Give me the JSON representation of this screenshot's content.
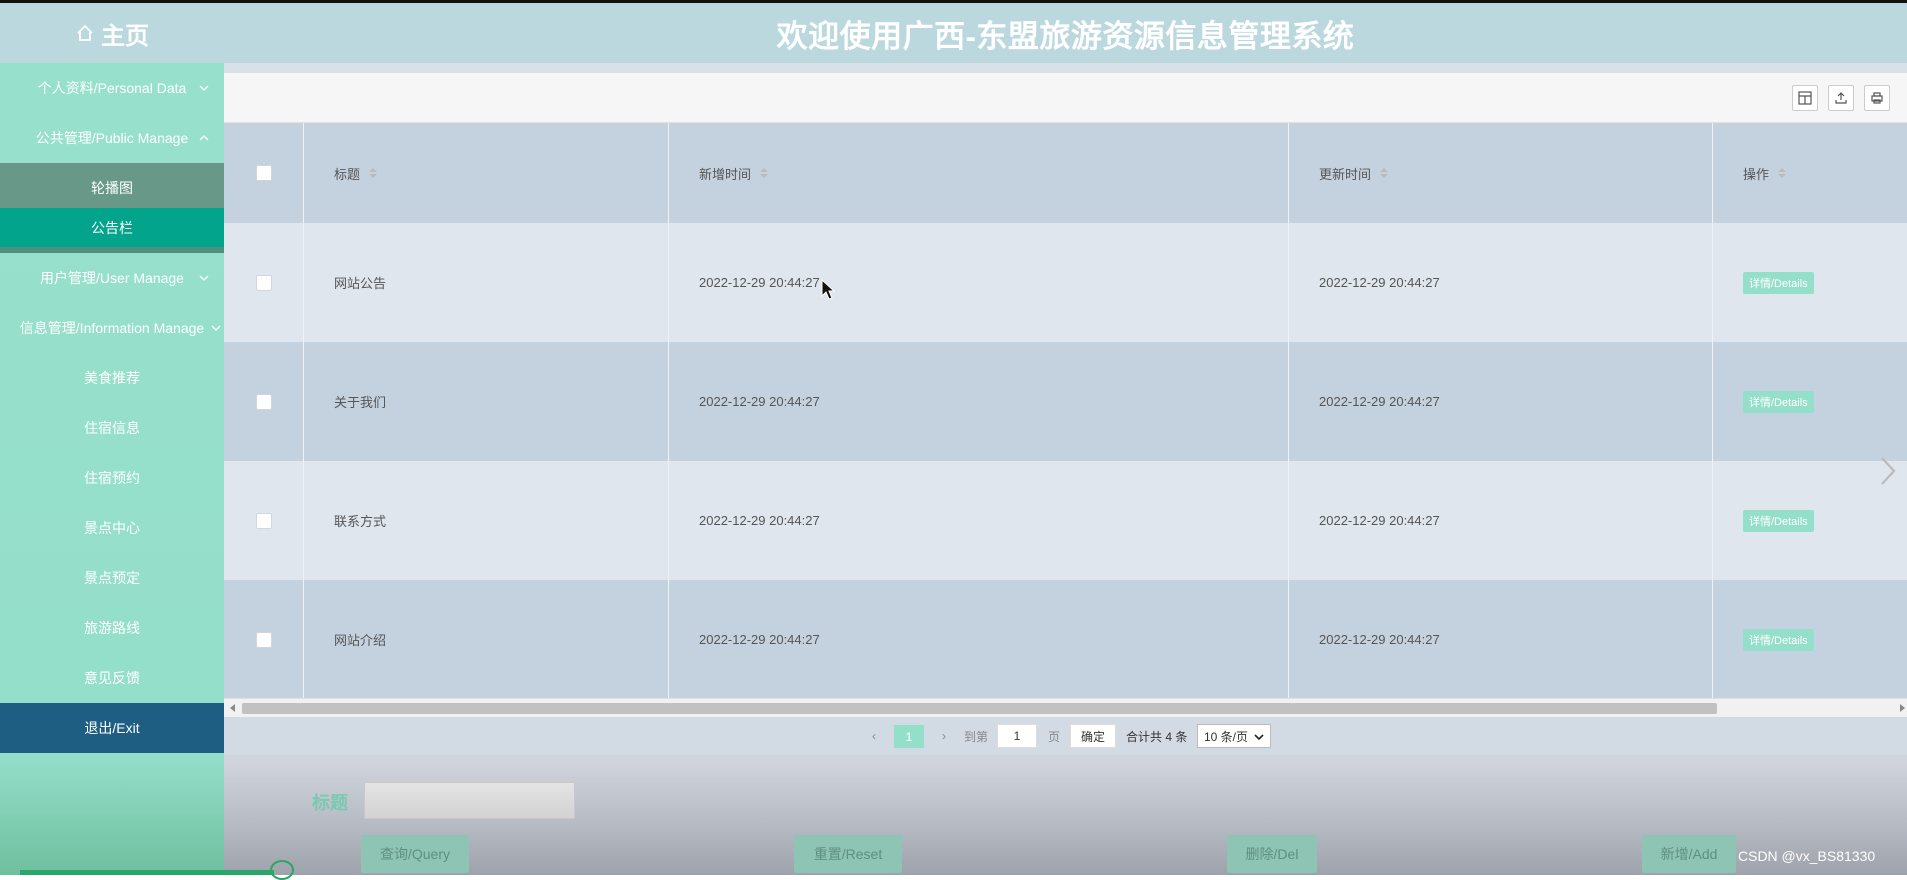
{
  "header": {
    "home_label": "主页",
    "system_title": "欢迎使用广西-东盟旅游资源信息管理系统"
  },
  "sidebar": {
    "items": [
      {
        "label": "个人资料/Personal Data"
      },
      {
        "label": "公共管理/Public Manage"
      },
      {
        "label": "用户管理/User Manage"
      },
      {
        "label": "信息管理/Information Manage"
      }
    ],
    "public_sub": [
      {
        "label": "轮播图"
      },
      {
        "label": "公告栏"
      }
    ],
    "info_sub": [
      {
        "label": "美食推荐"
      },
      {
        "label": "住宿信息"
      },
      {
        "label": "住宿预约"
      },
      {
        "label": "景点中心"
      },
      {
        "label": "景点预定"
      },
      {
        "label": "旅游路线"
      },
      {
        "label": "意见反馈"
      }
    ],
    "exit_label": "退出/Exit"
  },
  "toolbar": {
    "icons": [
      "columns-icon",
      "export-icon",
      "print-icon"
    ]
  },
  "table": {
    "headers": [
      "标题",
      "新增时间",
      "更新时间",
      "操作"
    ],
    "rows": [
      {
        "title": "网站公告",
        "added": "2022-12-29 20:44:27",
        "updated": "2022-12-29 20:44:27",
        "action": "详情/Details"
      },
      {
        "title": "关于我们",
        "added": "2022-12-29 20:44:27",
        "updated": "2022-12-29 20:44:27",
        "action": "详情/Details"
      },
      {
        "title": "联系方式",
        "added": "2022-12-29 20:44:27",
        "updated": "2022-12-29 20:44:27",
        "action": "详情/Details"
      },
      {
        "title": "网站介绍",
        "added": "2022-12-29 20:44:27",
        "updated": "2022-12-29 20:44:27",
        "action": "详情/Details"
      }
    ]
  },
  "pagination": {
    "current_page": "1",
    "goto_label": "到第",
    "goto_value": "1",
    "page_unit": "页",
    "confirm_label": "确定",
    "total_label": "合计共 4 条",
    "page_size": "10 条/页"
  },
  "search": {
    "title_label": "标题",
    "title_value": ""
  },
  "actions": {
    "query": "查询/Query",
    "reset": "重置/Reset",
    "delete": "删除/Del",
    "add": "新增/Add"
  },
  "watermark": "CSDN @vx_BS81330",
  "colors": {
    "header_bg": "#bcd8df",
    "sidebar_bg": "#97e0cc",
    "active_sub": "#02a48c",
    "exit_bg": "#1e5e83",
    "accent": "#94dfca"
  }
}
